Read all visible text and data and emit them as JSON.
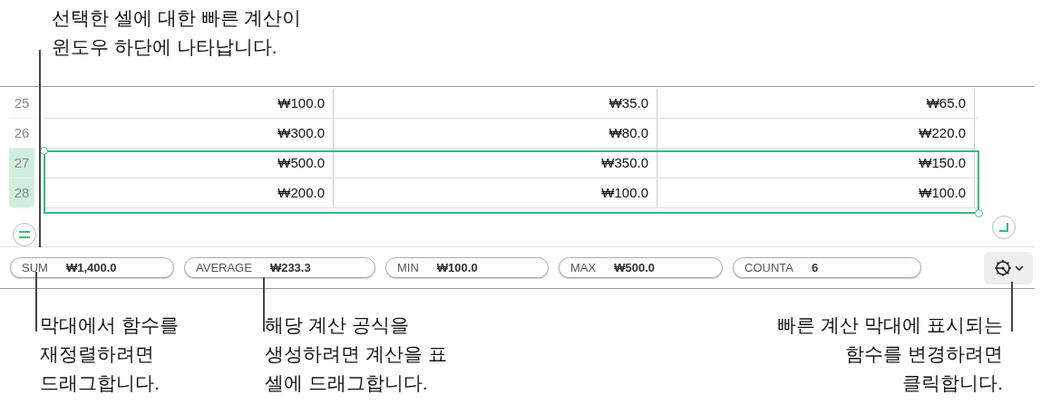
{
  "top_callout": {
    "lines": [
      "선택한 셀에 대한 빠른 계산이",
      "윈도우 하단에 나타납니다."
    ]
  },
  "table": {
    "rows": [
      {
        "number": "25",
        "selected": false,
        "cells": [
          "₩100.0",
          "₩35.0",
          "₩65.0"
        ]
      },
      {
        "number": "26",
        "selected": false,
        "cells": [
          "₩300.0",
          "₩80.0",
          "₩220.0"
        ]
      },
      {
        "number": "27",
        "selected": true,
        "cells": [
          "₩500.0",
          "₩350.0",
          "₩150.0"
        ]
      },
      {
        "number": "28",
        "selected": true,
        "cells": [
          "₩200.0",
          "₩100.0",
          "₩100.0"
        ]
      }
    ]
  },
  "quick_calc": [
    {
      "name": "SUM",
      "value": "₩1,400.0"
    },
    {
      "name": "AVERAGE",
      "value": "₩233.3"
    },
    {
      "name": "MIN",
      "value": "₩100.0"
    },
    {
      "name": "MAX",
      "value": "₩500.0"
    },
    {
      "name": "COUNTA",
      "value": "6"
    }
  ],
  "bottom_callouts": [
    {
      "lines": [
        "막대에서 함수를",
        "재정렬하려면",
        "드래그합니다."
      ]
    },
    {
      "lines": [
        "해당 계산 공식을",
        "생성하려면 계산을 표",
        "셀에 드래그합니다."
      ]
    },
    {
      "lines": [
        "빠른 계산 막대에 표시되는",
        "함수를 변경하려면",
        "클릭합니다."
      ]
    }
  ]
}
